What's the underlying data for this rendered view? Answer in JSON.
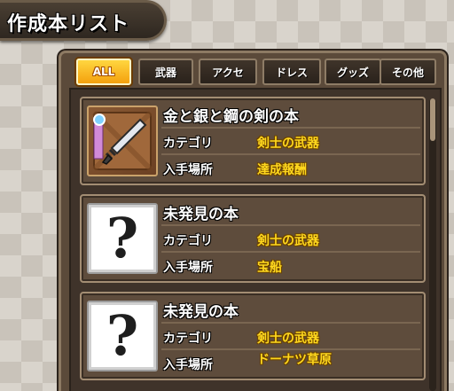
{
  "header": {
    "title": "作成本リスト"
  },
  "tabs": [
    {
      "label": "ALL",
      "active": true
    },
    {
      "label": "武器",
      "active": false
    },
    {
      "label": "アクセ",
      "active": false
    },
    {
      "label": "ドレス",
      "active": false
    },
    {
      "label": "グッズ",
      "active": false
    },
    {
      "label": "その他",
      "active": false
    }
  ],
  "labels": {
    "category": "カテゴリ",
    "obtain": "入手場所"
  },
  "books": [
    {
      "title": "金と銀と鋼の剣の本",
      "category": "剣士の武器",
      "location": "達成報酬",
      "thumb_icon": "sword-book-icon"
    },
    {
      "title": "未発見の本",
      "category": "剣士の武器",
      "location": "宝船",
      "thumb_icon": "question-mark-icon"
    },
    {
      "title": "未発見の本",
      "category": "剣士の武器",
      "location": "ドーナツ草原",
      "thumb_icon": "question-mark-icon"
    }
  ],
  "colors": {
    "accent": "#ffd81e",
    "active_tab": "#f4a10d"
  }
}
